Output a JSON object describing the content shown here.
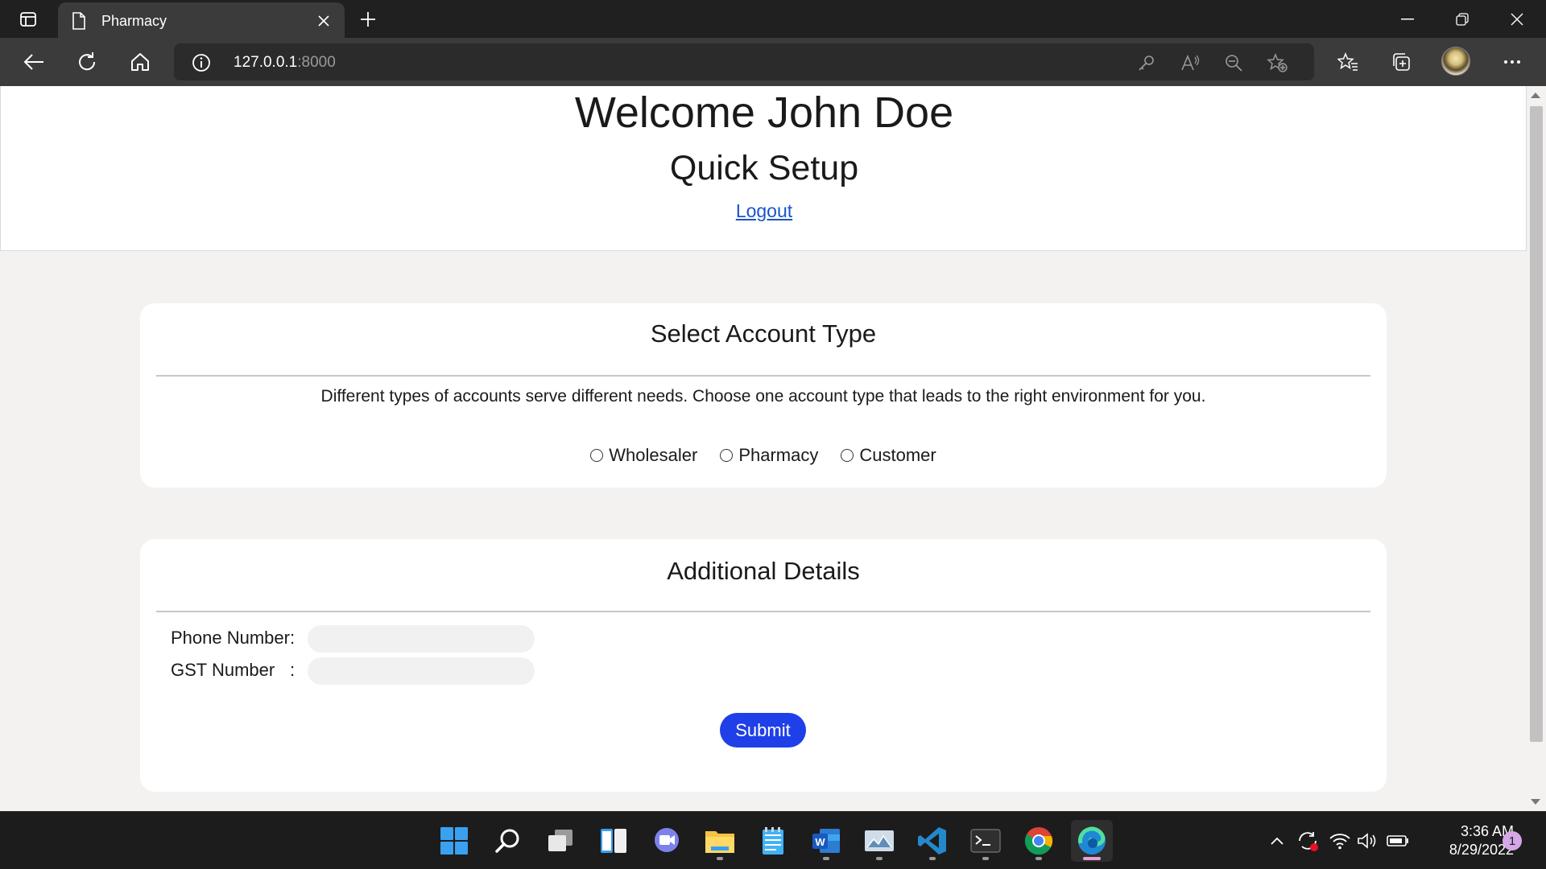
{
  "browser": {
    "tab_title": "Pharmacy",
    "url_host": "127.0.0.1",
    "url_port": ":8000"
  },
  "header": {
    "welcome": "Welcome John Doe",
    "subtitle": "Quick Setup",
    "logout": "Logout"
  },
  "account_type": {
    "title": "Select Account Type",
    "description": "Different types of accounts serve different needs. Choose one account type that leads to the right environment for you.",
    "options": [
      "Wholesaler",
      "Pharmacy",
      "Customer"
    ]
  },
  "details": {
    "title": "Additional Details",
    "phone_label": "Phone Number",
    "gst_label": "GST Number",
    "colon": ":",
    "phone_value": "",
    "gst_value": "",
    "submit": "Submit"
  },
  "taskbar": {
    "time": "3:36 AM",
    "date": "8/29/2022",
    "notifications": "1",
    "apps": [
      "start-icon",
      "search-icon",
      "task-view-icon",
      "widgets-icon",
      "chat-icon",
      "file-explorer-icon",
      "notepad-icon",
      "word-icon",
      "photos-icon",
      "vscode-icon",
      "terminal-icon",
      "chrome-icon",
      "edge-icon"
    ]
  },
  "colors": {
    "accent_button": "#1f3fe8",
    "link": "#1a53c9",
    "page_bg": "#f3f2f1",
    "chrome_bg": "#202020"
  }
}
